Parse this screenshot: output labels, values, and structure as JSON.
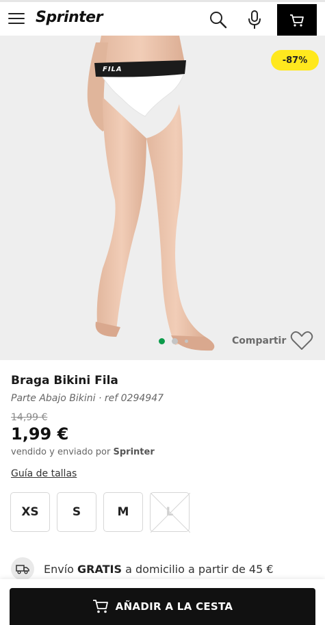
{
  "header": {
    "logo": "Sprinter",
    "icons": [
      "menu-icon",
      "search-icon",
      "microphone-icon",
      "cart-icon"
    ]
  },
  "hero": {
    "discount_badge": "-87%",
    "carousel": {
      "slides": 3,
      "active_index": 0
    },
    "share_label": "Compartir",
    "brand_print": "FILA"
  },
  "product": {
    "title": "Braga Bikini Fila",
    "category": "Parte Abajo Bikini",
    "separator": "·",
    "reference": "ref 0294947",
    "old_price": "14,99 €",
    "price": "1,99 €",
    "seller_prefix": "vendido y enviado por",
    "seller_name": "Sprinter",
    "size_guide_label": "Guía de tallas",
    "sizes": [
      {
        "label": "XS",
        "available": true
      },
      {
        "label": "S",
        "available": true
      },
      {
        "label": "M",
        "available": true
      },
      {
        "label": "L",
        "available": false
      }
    ]
  },
  "shipping": {
    "prefix": "Envío",
    "highlight": "GRATIS",
    "suffix": "a domicilio a partir de 45 €"
  },
  "cta": {
    "add_to_cart_label": "AÑADIR A LA CESTA"
  },
  "colors": {
    "badge_yellow": "#ffe81e",
    "active_dot": "#0c9b4b",
    "cta_background": "#111111"
  }
}
